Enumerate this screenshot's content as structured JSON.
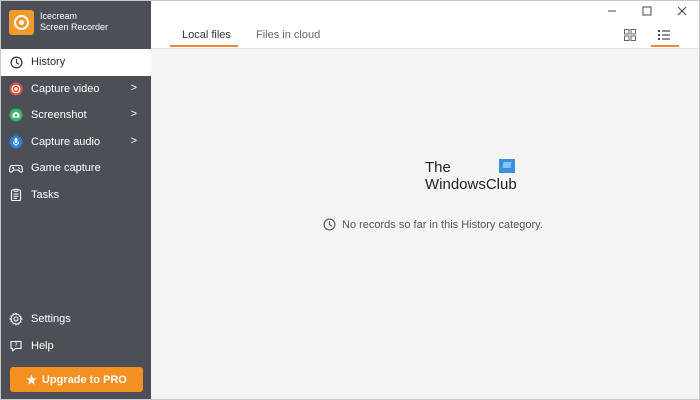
{
  "app": {
    "title_line1": "Icecream",
    "title_line2": "Screen Recorder"
  },
  "sidebar": {
    "items": [
      {
        "label": "History",
        "icon": "clock-icon"
      },
      {
        "label": "Capture video",
        "icon": "record-icon",
        "color": "#e5533d"
      },
      {
        "label": "Screenshot",
        "icon": "camera-icon",
        "color": "#35b36a"
      },
      {
        "label": "Capture audio",
        "icon": "microphone-icon",
        "color": "#2f7fd6"
      },
      {
        "label": "Game capture",
        "icon": "gamepad-icon"
      },
      {
        "label": "Tasks",
        "icon": "tasks-icon"
      }
    ],
    "bottom_items": [
      {
        "label": "Settings",
        "icon": "gear-icon"
      },
      {
        "label": "Help",
        "icon": "help-icon"
      }
    ],
    "upgrade_label": "Upgrade to PRO"
  },
  "tabs": {
    "local": "Local files",
    "cloud": "Files in cloud"
  },
  "watermark": {
    "line1": "The",
    "line2": "WindowsClub"
  },
  "empty_state": {
    "message": "No records so far in this History category."
  },
  "colors": {
    "sidebar_bg": "#4a5056",
    "accent": "#f3901f"
  }
}
